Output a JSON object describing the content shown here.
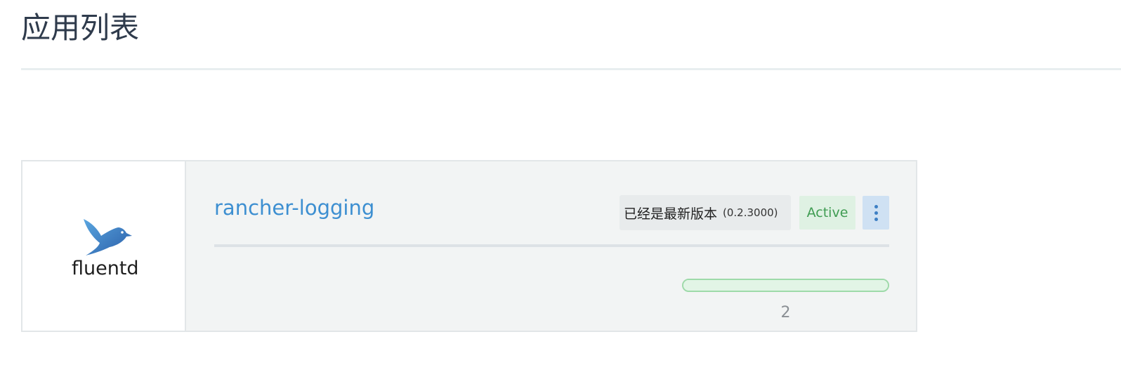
{
  "page": {
    "title": "应用列表"
  },
  "app": {
    "logo_text": "fluentd",
    "name": "rancher-logging",
    "version_status": "已经是最新版本",
    "version": "(0.2.3000)",
    "state": "Active",
    "progress_fraction": 1.0,
    "count": "2",
    "more_icon": "vertical-ellipsis-icon",
    "colors": {
      "name": "#3d8fd1",
      "state_text": "#3f9c52",
      "state_bg": "#dff1e3",
      "progress_border": "#9edaa9"
    }
  }
}
